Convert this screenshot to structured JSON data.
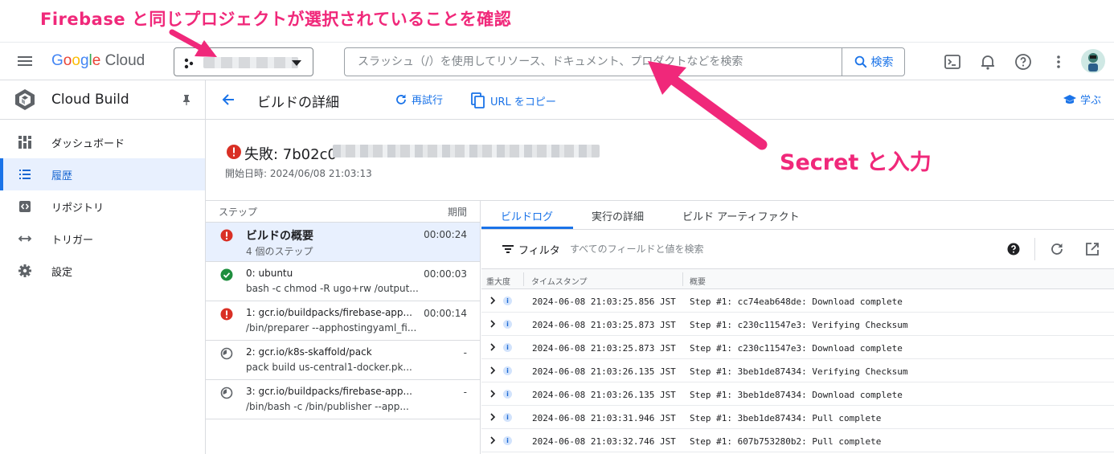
{
  "annotations": {
    "project_note": "Firebase と同じプロジェクトが選択されていることを確認",
    "search_note": "Secret と入力"
  },
  "topbar": {
    "logo_google": [
      "G",
      "o",
      "o",
      "g",
      "l",
      "e"
    ],
    "logo_cloud": "Cloud",
    "search_placeholder": "スラッシュ（/）を使用してリソース、ドキュメント、プロダクトなどを検索",
    "search_button": "検索"
  },
  "sidebar": {
    "product_name": "Cloud Build",
    "items": [
      {
        "label": "ダッシュボード",
        "icon": "dashboard-icon"
      },
      {
        "label": "履歴",
        "icon": "list-icon",
        "active": true
      },
      {
        "label": "リポジトリ",
        "icon": "repository-icon"
      },
      {
        "label": "トリガー",
        "icon": "trigger-icon"
      },
      {
        "label": "設定",
        "icon": "gear-icon"
      }
    ]
  },
  "header": {
    "title": "ビルドの詳細",
    "retry": "再試行",
    "copy_url": "URL をコピー",
    "learn": "学ぶ"
  },
  "build": {
    "status_id": "失敗: 7b02c0",
    "start_time": "開始日時: 2024/06/08 21:03:13"
  },
  "steps": {
    "col_step": "ステップ",
    "col_duration": "期間",
    "items": [
      {
        "name": "ビルドの概要",
        "cmd": "4 個のステップ",
        "duration": "00:00:24",
        "status": "error"
      },
      {
        "name": "0: ubuntu",
        "cmd": "bash -c chmod -R ugo+rw /output...",
        "duration": "00:00:03",
        "status": "success"
      },
      {
        "name": "1: gcr.io/buildpacks/firebase-app...",
        "cmd": "/bin/preparer --apphostingyaml_fi...",
        "duration": "00:00:14",
        "status": "error"
      },
      {
        "name": "2: gcr.io/k8s-skaffold/pack",
        "cmd": "pack build us-central1-docker.pk...",
        "duration": "-",
        "status": "pending"
      },
      {
        "name": "3: gcr.io/buildpacks/firebase-app...",
        "cmd": "/bin/bash -c /bin/publisher --app...",
        "duration": "-",
        "status": "pending"
      }
    ]
  },
  "logs": {
    "tabs": [
      "ビルドログ",
      "実行の詳細",
      "ビルド アーティファクト"
    ],
    "filter_label": "フィルタ",
    "filter_placeholder": "すべてのフィールドと値を検索",
    "col_severity": "重大度",
    "col_timestamp": "タイムスタンプ",
    "col_summary": "概要",
    "info_glyph": "i",
    "rows": [
      {
        "ts": "2024-06-08 21:03:25.856 JST",
        "msg": "Step #1: cc74eab648de: Download complete"
      },
      {
        "ts": "2024-06-08 21:03:25.873 JST",
        "msg": "Step #1: c230c11547e3: Verifying Checksum"
      },
      {
        "ts": "2024-06-08 21:03:25.873 JST",
        "msg": "Step #1: c230c11547e3: Download complete"
      },
      {
        "ts": "2024-06-08 21:03:26.135 JST",
        "msg": "Step #1: 3beb1de87434: Verifying Checksum"
      },
      {
        "ts": "2024-06-08 21:03:26.135 JST",
        "msg": "Step #1: 3beb1de87434: Download complete"
      },
      {
        "ts": "2024-06-08 21:03:31.946 JST",
        "msg": "Step #1: 3beb1de87434: Pull complete"
      },
      {
        "ts": "2024-06-08 21:03:32.746 JST",
        "msg": "Step #1: 607b753280b2: Pull complete"
      }
    ]
  },
  "colors": {
    "accent": "#1a73e8",
    "annotation": "#f0287a",
    "error": "#d93025",
    "success": "#1e8e3e"
  }
}
